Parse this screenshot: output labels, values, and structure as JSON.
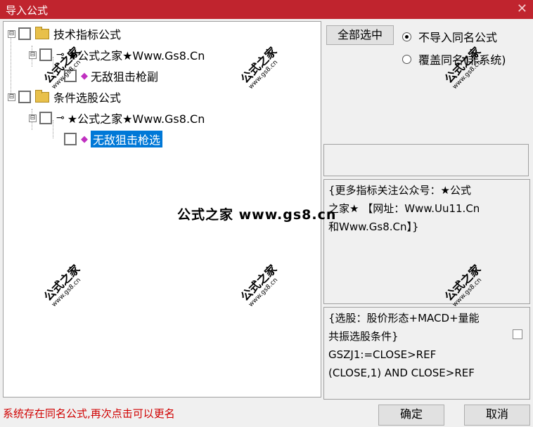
{
  "window": {
    "title": "导入公式",
    "close": "✕"
  },
  "tree": [
    {
      "label": "技术指标公式",
      "icon": "folder",
      "expander": "⊟"
    },
    {
      "label": "★公式之家★Www.Gs8.Cn",
      "icon": "key",
      "expander": "⊟"
    },
    {
      "label": "无敌狙击枪副",
      "icon": "gem"
    },
    {
      "label": "条件选股公式",
      "icon": "folder",
      "expander": "⊟"
    },
    {
      "label": "★公式之家★Www.Gs8.Cn",
      "icon": "key",
      "expander": "⊟"
    },
    {
      "label": "无敌狙击枪选",
      "icon": "gem",
      "selected": true
    }
  ],
  "right": {
    "select_all": "全部选中",
    "radios": [
      {
        "label": "不导入同名公式",
        "checked": true
      },
      {
        "label": "覆盖同名(非系统)",
        "checked": false
      }
    ],
    "description": "{更多指标关注公众号：★公式\n之家★ 【网址：Www.Uu11.Cn\n和Www.Gs8.Cn】}",
    "formula": "{选股：股价形态+MACD+量能\n共振选股条件}\nGSZJ1:=CLOSE>REF\n(CLOSE,1) AND CLOSE>REF"
  },
  "status": "系统存在同名公式,再次点击可以更名",
  "buttons": {
    "ok": "确定",
    "cancel": "取消"
  },
  "watermark": {
    "main": "公式之家",
    "url": "www.gs8.cn",
    "center": "公式之家 www.gs8.cn"
  },
  "colors": {
    "titlebar": "#c0242e",
    "selection": "#0078d7",
    "status": "#d00000"
  }
}
